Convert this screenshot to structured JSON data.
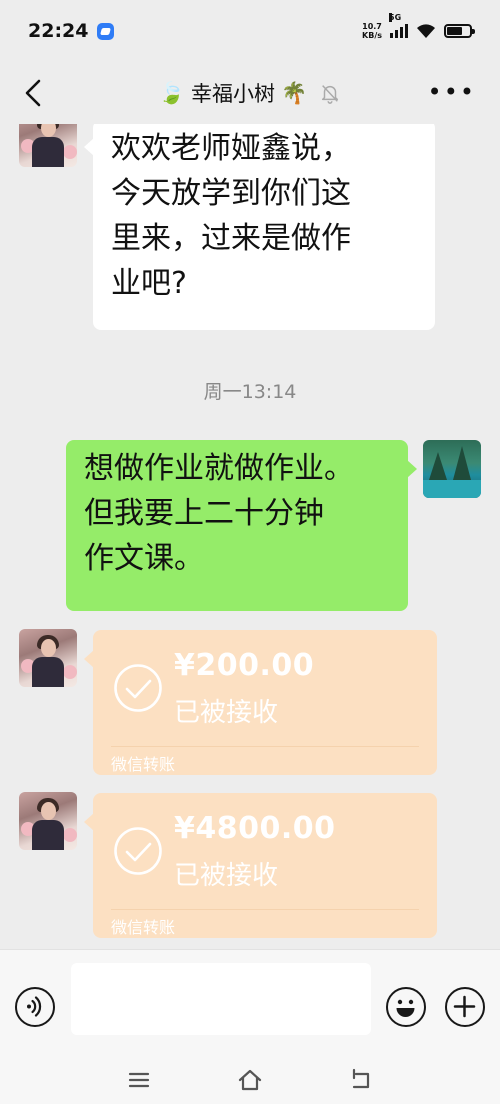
{
  "status_bar": {
    "time": "22:24",
    "net_speed_value": "10.7",
    "net_speed_unit": "KB/s",
    "network": "5G",
    "battery_percent": 70
  },
  "header": {
    "title_prefix_emoji": "🍃",
    "title": "幸福小树",
    "title_suffix_emoji": "🌴",
    "muted": true
  },
  "messages": {
    "m1": {
      "lines": [
        "欢欢老师娅鑫说，",
        "今天放学到你们这",
        "里来，过来是做作",
        "业吧?"
      ]
    },
    "timestamp": "周一13:14",
    "m2": {
      "lines": [
        "想做作业就做作业。",
        "但我要上二十分钟",
        "作文课。"
      ]
    },
    "transfer1": {
      "amount": "¥200.00",
      "state": "已被接收",
      "brand": "微信转账"
    },
    "transfer2": {
      "amount": "¥4800.00",
      "state": "已被接收",
      "brand": "微信转账"
    }
  },
  "colors": {
    "background": "#ededed",
    "sent_bubble": "#95ec69",
    "received_bubble": "#ffffff",
    "transfer_card": "#fce0c2"
  }
}
